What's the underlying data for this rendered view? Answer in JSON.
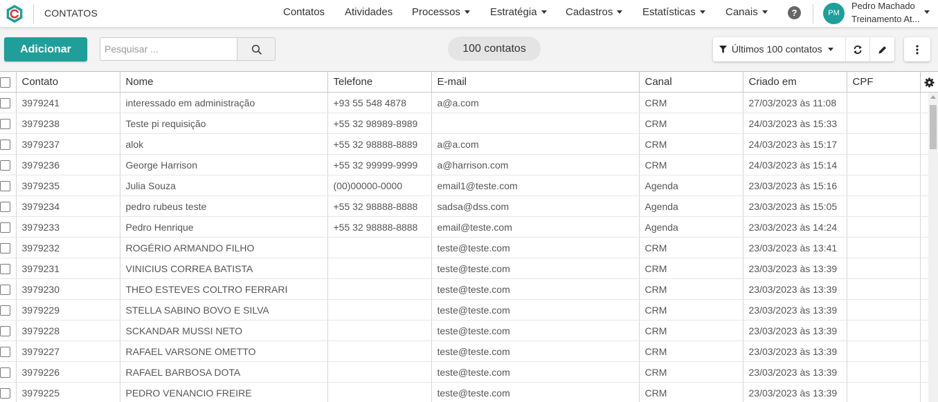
{
  "app": {
    "title": "CONTATOS"
  },
  "nav": {
    "items": [
      {
        "label": "Contatos",
        "dropdown": false
      },
      {
        "label": "Atividades",
        "dropdown": false
      },
      {
        "label": "Processos",
        "dropdown": true
      },
      {
        "label": "Estratégia",
        "dropdown": true
      },
      {
        "label": "Cadastros",
        "dropdown": true
      },
      {
        "label": "Estatísticas",
        "dropdown": true
      },
      {
        "label": "Canais",
        "dropdown": true
      }
    ],
    "help_icon": "question-circle-icon"
  },
  "user": {
    "initials": "PM",
    "name": "Pedro Machado",
    "org": "Treinamento At..."
  },
  "colors": {
    "accent": "#1f9e9a",
    "pill": "#e4e4e4"
  },
  "toolbar": {
    "add_label": "Adicionar",
    "search_placeholder": "Pesquisar ...",
    "search_value": "",
    "count_label": "100 contatos",
    "filter_label": "Últimos 100 contatos",
    "icons": [
      "funnel-icon",
      "refresh-icon",
      "pencil-icon",
      "kebab-menu-icon",
      "search-icon"
    ]
  },
  "table": {
    "columns": [
      "Contato",
      "Nome",
      "Telefone",
      "E-mail",
      "Canal",
      "Criado em",
      "CPF"
    ],
    "rows": [
      {
        "id": "3979241",
        "name": "interessado em administração",
        "phone": "+93 55 548 4878",
        "email": "a@a.com",
        "channel": "CRM",
        "created": "27/03/2023 às 11:08",
        "cpf": ""
      },
      {
        "id": "3979238",
        "name": "Teste pi requisição",
        "phone": "+55 32 98989-8989",
        "email": "",
        "channel": "CRM",
        "created": "24/03/2023 às 15:33",
        "cpf": ""
      },
      {
        "id": "3979237",
        "name": "alok",
        "phone": "+55 32 98888-8889",
        "email": "a@a.com",
        "channel": "CRM",
        "created": "24/03/2023 às 15:17",
        "cpf": ""
      },
      {
        "id": "3979236",
        "name": "George Harrison",
        "phone": "+55 32 99999-9999",
        "email": "a@harrison.com",
        "channel": "CRM",
        "created": "24/03/2023 às 15:14",
        "cpf": ""
      },
      {
        "id": "3979235",
        "name": "Julia Souza",
        "phone": "(00)00000-0000",
        "email": "email1@teste.com",
        "channel": "Agenda",
        "created": "23/03/2023 às 15:16",
        "cpf": ""
      },
      {
        "id": "3979234",
        "name": "pedro rubeus teste",
        "phone": "+55 32 98888-8888",
        "email": "sadsa@dss.com",
        "channel": "Agenda",
        "created": "23/03/2023 às 15:05",
        "cpf": ""
      },
      {
        "id": "3979233",
        "name": "Pedro Henrique",
        "phone": "+55 32 98888-8888",
        "email": "email@teste.com",
        "channel": "Agenda",
        "created": "23/03/2023 às 14:24",
        "cpf": ""
      },
      {
        "id": "3979232",
        "name": "ROGÉRIO ARMANDO FILHO",
        "phone": "",
        "email": "teste@teste.com",
        "channel": "CRM",
        "created": "23/03/2023 às 13:41",
        "cpf": ""
      },
      {
        "id": "3979231",
        "name": "VINICIUS CORREA BATISTA",
        "phone": "",
        "email": "teste@teste.com",
        "channel": "CRM",
        "created": "23/03/2023 às 13:39",
        "cpf": ""
      },
      {
        "id": "3979230",
        "name": "THEO ESTEVES COLTRO FERRARI",
        "phone": "",
        "email": "teste@teste.com",
        "channel": "CRM",
        "created": "23/03/2023 às 13:39",
        "cpf": ""
      },
      {
        "id": "3979229",
        "name": "STELLA SABINO BOVO E SILVA",
        "phone": "",
        "email": "teste@teste.com",
        "channel": "CRM",
        "created": "23/03/2023 às 13:39",
        "cpf": ""
      },
      {
        "id": "3979228",
        "name": "SCKANDAR MUSSI NETO",
        "phone": "",
        "email": "teste@teste.com",
        "channel": "CRM",
        "created": "23/03/2023 às 13:39",
        "cpf": ""
      },
      {
        "id": "3979227",
        "name": "RAFAEL VARSONE OMETTO",
        "phone": "",
        "email": "teste@teste.com",
        "channel": "CRM",
        "created": "23/03/2023 às 13:39",
        "cpf": ""
      },
      {
        "id": "3979226",
        "name": "RAFAEL BARBOSA DOTA",
        "phone": "",
        "email": "teste@teste.com",
        "channel": "CRM",
        "created": "23/03/2023 às 13:39",
        "cpf": ""
      },
      {
        "id": "3979225",
        "name": "PEDRO VENANCIO FREIRE",
        "phone": "",
        "email": "teste@teste.com",
        "channel": "CRM",
        "created": "23/03/2023 às 13:39",
        "cpf": ""
      }
    ],
    "settings_icon": "gear-icon"
  }
}
